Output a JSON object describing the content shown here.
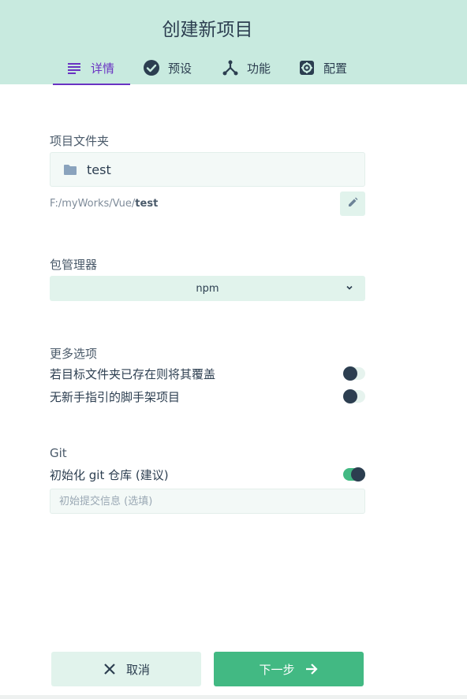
{
  "header": {
    "title": "创建新项目",
    "tabs": [
      {
        "label": "详情",
        "icon": "list-icon",
        "active": true
      },
      {
        "label": "预设",
        "icon": "check-circle-icon",
        "active": false
      },
      {
        "label": "功能",
        "icon": "fork-icon",
        "active": false
      },
      {
        "label": "配置",
        "icon": "settings-icon",
        "active": false
      }
    ]
  },
  "folder": {
    "label": "项目文件夹",
    "value": "test",
    "path_prefix": "F:/myWorks/Vue/",
    "path_name": "test",
    "icon": "folder-icon",
    "edit_icon": "pencil-icon"
  },
  "package_manager": {
    "label": "包管理器",
    "selected": "npm",
    "icon": "chevron-down-icon"
  },
  "more_options": {
    "label": "更多选项",
    "items": [
      {
        "label": "若目标文件夹已存在则将其覆盖",
        "enabled": false
      },
      {
        "label": "无新手指引的脚手架项目",
        "enabled": false
      }
    ]
  },
  "git": {
    "label": "Git",
    "init_label": "初始化 git 仓库 (建议)",
    "init_enabled": true,
    "commit_placeholder": "初始提交信息 (选填)",
    "commit_value": ""
  },
  "footer": {
    "cancel_label": "取消",
    "next_label": "下一步"
  },
  "colors": {
    "header_bg": "#c8eadf",
    "accent": "#42b983",
    "active_tab": "#6a33c2",
    "text": "#2c3e50"
  }
}
